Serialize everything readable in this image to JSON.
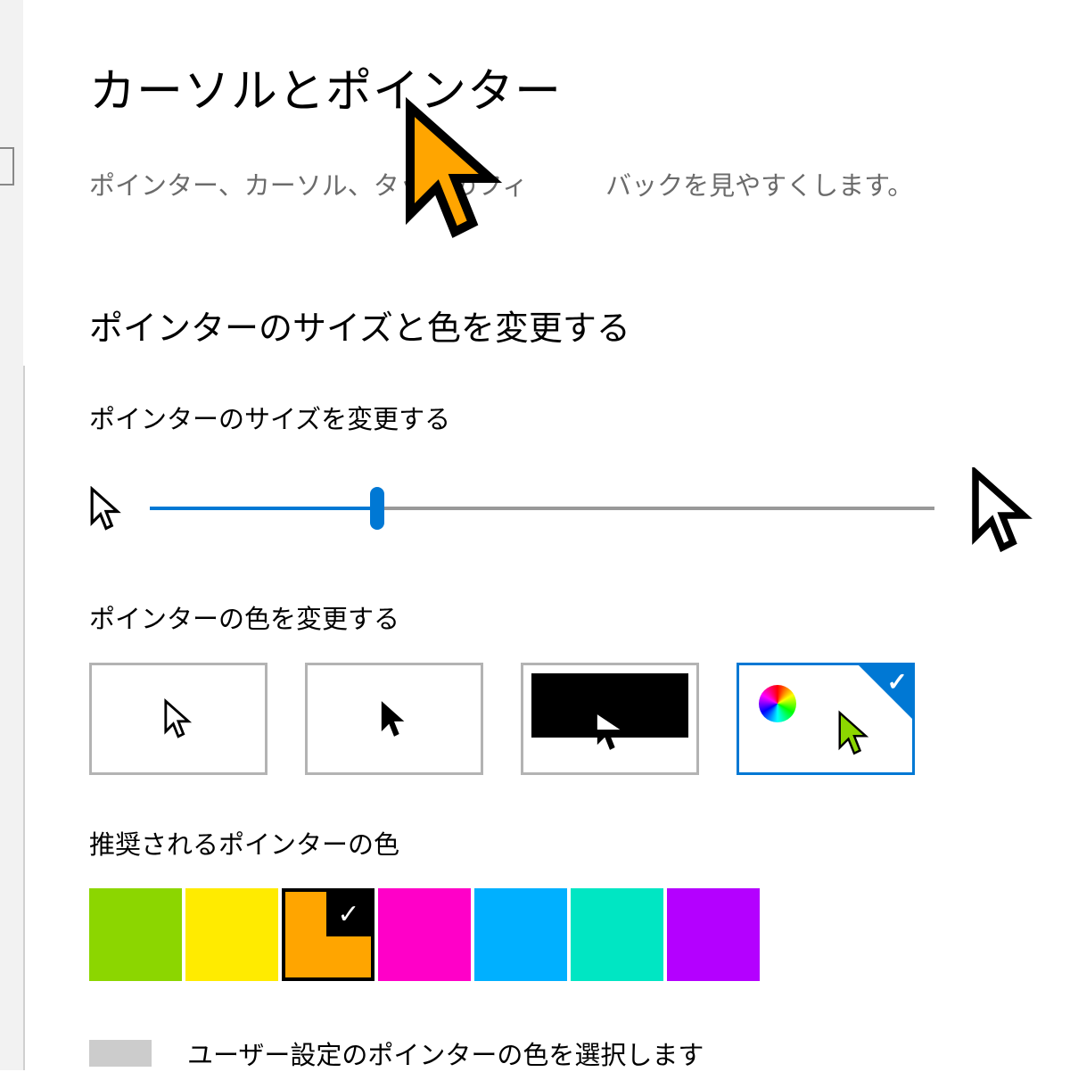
{
  "page": {
    "title": "カーソルとポインター",
    "subtitle": "ポインター、カーソル、タッチのフィ　　　バックを見やすくします。"
  },
  "section": {
    "heading": "ポインターのサイズと色を変更する",
    "size_label": "ポインターのサイズを変更する",
    "color_label": "ポインターの色を変更する",
    "recommended_label": "推奨されるポインターの色",
    "custom_label": "ユーザー設定のポインターの色を選択します"
  },
  "slider": {
    "value_percent": 29
  },
  "color_modes": {
    "selected_index": 3,
    "items": [
      {
        "id": "white"
      },
      {
        "id": "black"
      },
      {
        "id": "inverted"
      },
      {
        "id": "custom"
      }
    ]
  },
  "swatches": {
    "selected_index": 2,
    "colors": [
      "#8cd600",
      "#ffeb00",
      "#ffa500",
      "#ff00c8",
      "#00b0ff",
      "#00e6c3",
      "#b400ff"
    ]
  },
  "hero_cursor_color": "#ffa500"
}
